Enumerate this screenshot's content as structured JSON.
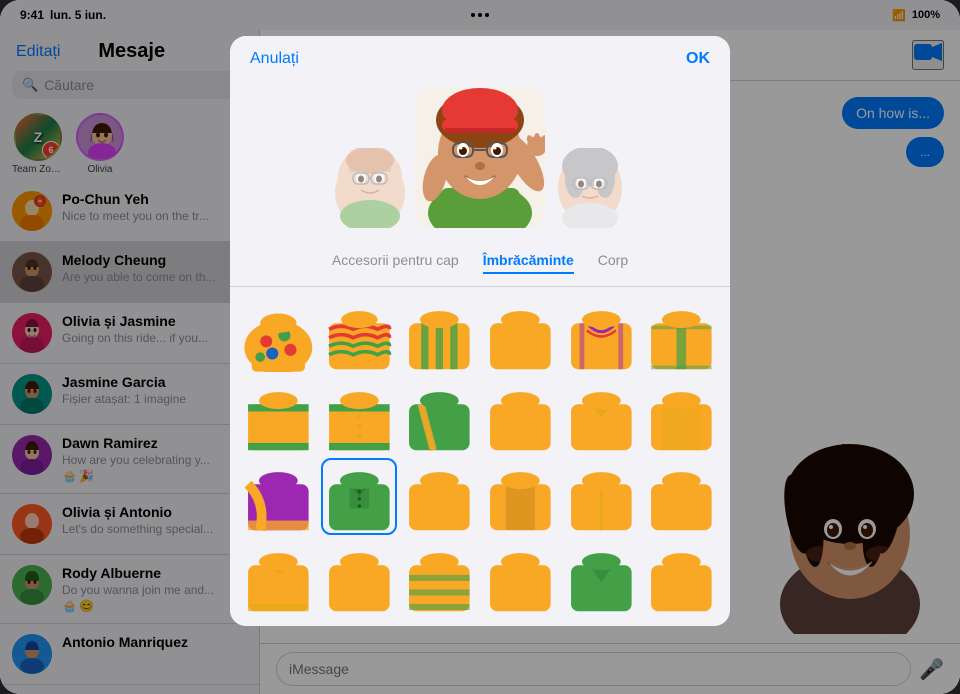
{
  "statusBar": {
    "time": "9:41",
    "day": "lun. 5 iun.",
    "wifi": "▲",
    "battery": "100%",
    "dots": [
      "•",
      "•",
      "•"
    ]
  },
  "sidebar": {
    "editLabel": "Editați",
    "title": "Mesaje",
    "searchPlaceholder": "Căutare",
    "stories": [
      {
        "label": "Team Zoetrope",
        "type": "team"
      },
      {
        "label": "Olivia",
        "type": "olivia"
      }
    ],
    "conversations": [
      {
        "name": "Po-Chun Yeh",
        "preview": "Nice to meet you on the tr...",
        "type": "person",
        "emoji": "🦜",
        "active": false
      },
      {
        "name": "Melody Cheung",
        "preview": "Are you able to come on the ride or not?",
        "type": "person",
        "active": true
      },
      {
        "name": "Olivia și Jasmine",
        "preview": "Going on this ride... if you come too you're welcome",
        "type": "group",
        "active": false
      },
      {
        "name": "Jasmine Garcia",
        "preview": "Fișier atașat: 1 imagine",
        "type": "person",
        "active": false
      },
      {
        "name": "Dawn Ramirez",
        "preview": "How are you celebrating your big day?",
        "type": "person",
        "active": false,
        "hasStickers": true
      },
      {
        "name": "Olivia și Antonio",
        "preview": "Let's do something special dawn at the next meeting ...",
        "type": "group",
        "active": false
      },
      {
        "name": "Rody Albuerne",
        "preview": "Do you wanna join me and... breakfast?",
        "type": "person",
        "active": false,
        "hasStickers": true
      },
      {
        "name": "Antonio Manriquez",
        "preview": "",
        "type": "person",
        "active": false
      }
    ]
  },
  "chat": {
    "messages": [
      {
        "text": "On how is..."
      },
      {
        "text": "..."
      }
    ],
    "inputPlaceholder": "iMessage",
    "videoIconLabel": "video-call"
  },
  "modal": {
    "cancelLabel": "Anulați",
    "okLabel": "OK",
    "tabs": [
      {
        "label": "Accesorii pentru cap",
        "active": false
      },
      {
        "label": "Îmbrăcăminte",
        "active": true
      },
      {
        "label": "Corp",
        "active": false
      }
    ],
    "clothingRows": 4,
    "clothingCols": 6,
    "selectedIndex": 7
  }
}
